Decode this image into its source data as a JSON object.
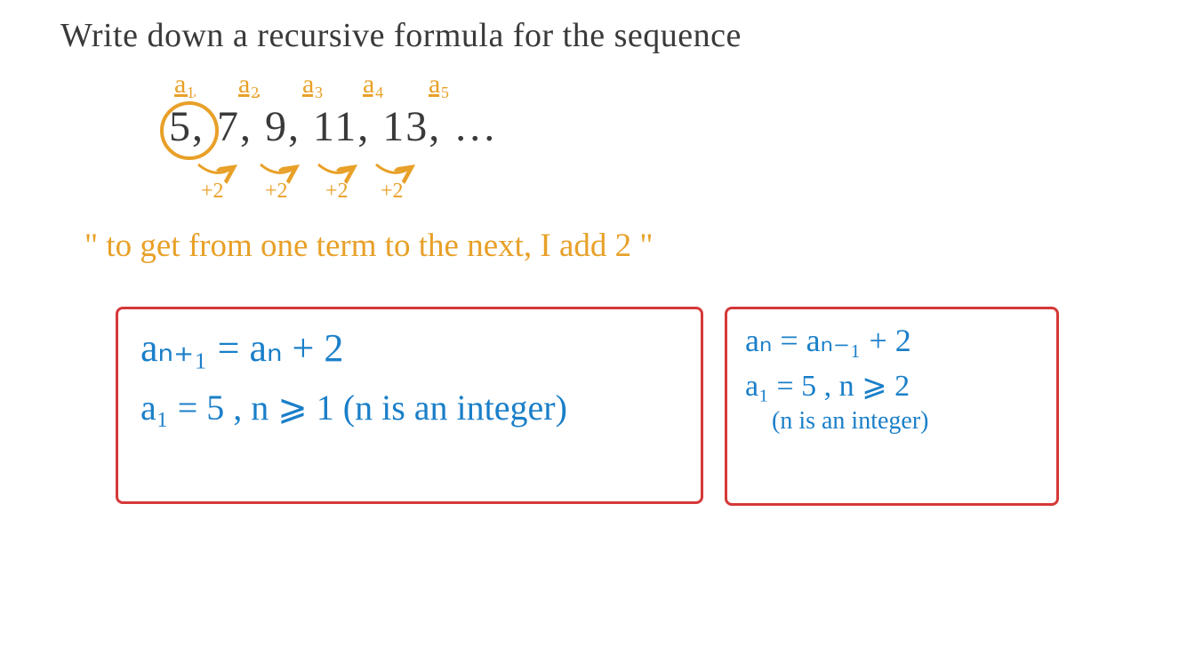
{
  "title": "Write down a recursive formula for the sequence",
  "labels": {
    "a1": "a₁",
    "a2": "a₂",
    "a3": "a₃",
    "a4": "a₄",
    "a5": "a₅"
  },
  "sequence": "5, 7, 9, 11, 13, …",
  "steps": {
    "s1": "+2",
    "s2": "+2",
    "s3": "+2",
    "s4": "+2"
  },
  "explanation": "\" to get from one term to the next, I add 2 \"",
  "formula1": {
    "line1": "aₙ₊₁ = aₙ + 2",
    "line2": "a₁ = 5 ,    n ⩾ 1   (n is an integer)"
  },
  "formula2": {
    "line1": "aₙ = aₙ₋₁ + 2",
    "line2": "a₁ = 5 , n ⩾ 2",
    "line3": "(n is an integer)"
  }
}
